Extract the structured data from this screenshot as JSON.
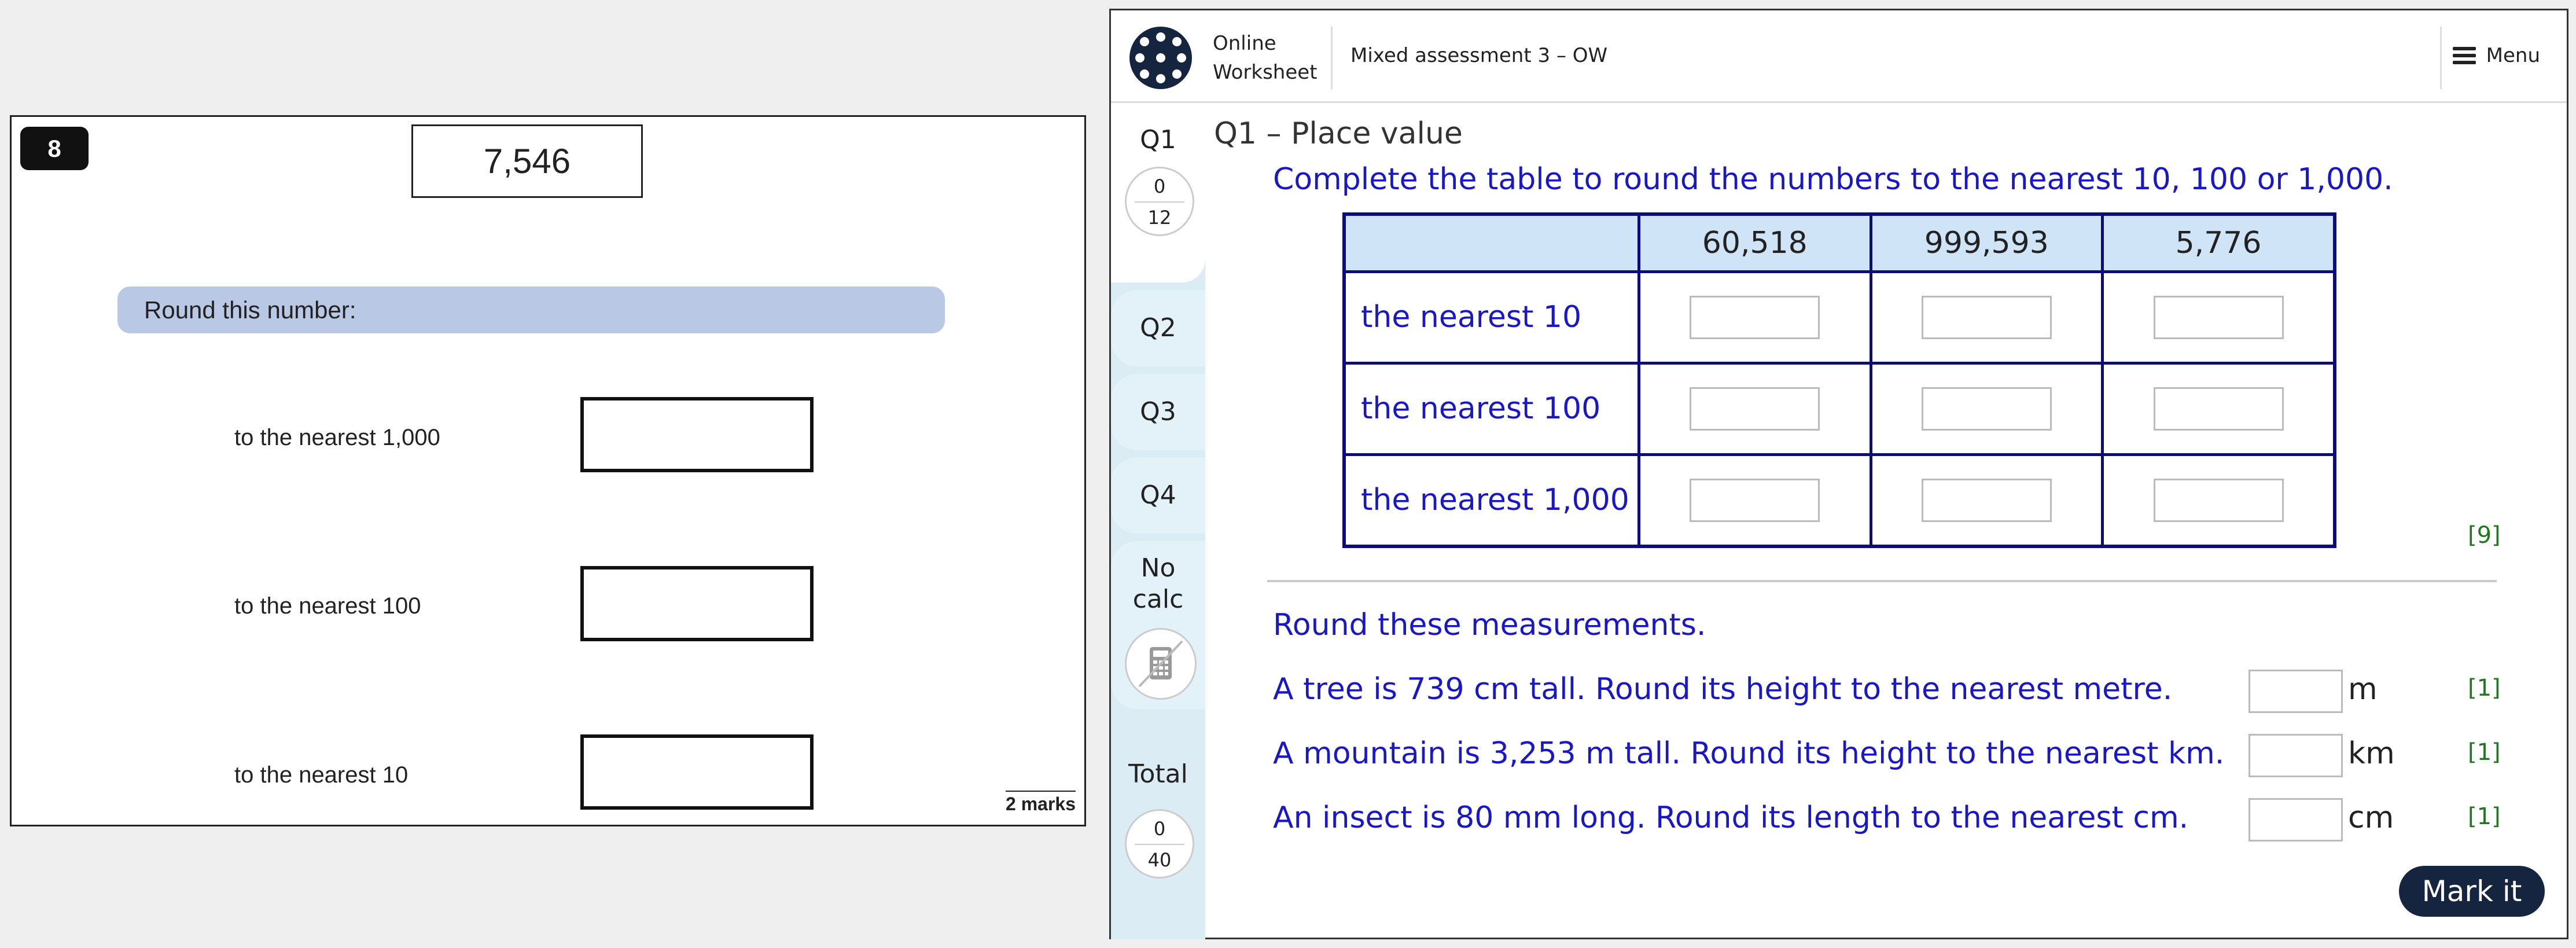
{
  "exam": {
    "question_number": "8",
    "number": "7,546",
    "instruction": "Round this number:",
    "rows": [
      {
        "label": "to the nearest 1,000"
      },
      {
        "label": "to the nearest 100"
      },
      {
        "label": "to the nearest 10"
      }
    ],
    "marks": "2 marks"
  },
  "worksheet": {
    "brand_line1": "Online",
    "brand_line2": "Worksheet",
    "title": "Mixed assessment 3 – OW",
    "menu_label": "Menu",
    "sidebar": {
      "q1": {
        "label": "Q1",
        "score": "0",
        "max": "12"
      },
      "q2": "Q2",
      "q3": "Q3",
      "q4": "Q4",
      "nocalc_line1": "No",
      "nocalc_line2": "calc",
      "total": {
        "label": "Total",
        "score": "0",
        "max": "40"
      }
    },
    "question_heading": "Q1 – Place value",
    "instruction": "Complete the table to round the numbers to the nearest 10, 100 or 1,000.",
    "table": {
      "columns": [
        "60,518",
        "999,593",
        "5,776"
      ],
      "rows": [
        "the nearest 10",
        "the nearest 100",
        "the nearest 1,000"
      ],
      "marks": "[9]"
    },
    "measurements_intro": "Round these measurements.",
    "measurements": [
      {
        "text": "A tree is 739 cm tall. Round its height to the nearest metre.",
        "unit": "m",
        "marks": "[1]"
      },
      {
        "text": "A mountain is 3,253 m tall. Round its height to the nearest km.",
        "unit": "km",
        "marks": "[1]"
      },
      {
        "text": "An insect is 80 mm long. Round its length to the nearest cm.",
        "unit": "cm",
        "marks": "[1]"
      }
    ],
    "mark_button": "Mark it"
  }
}
